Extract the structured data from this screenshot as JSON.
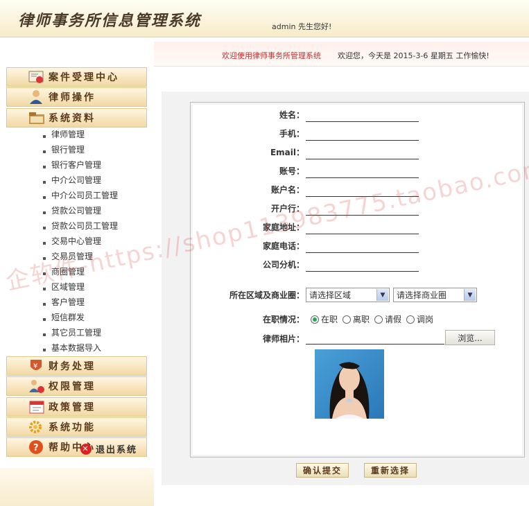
{
  "header": {
    "app_title": "律师事务所信息管理系统",
    "greeting": "admin 先生您好!"
  },
  "topbar": {
    "welcome": "欢迎使用律师事务所管理系统",
    "date_text": "欢迎您，今天是 2015-3-6 星期五 工作愉快!"
  },
  "sidebar": {
    "menus": [
      {
        "label": "案件受理中心",
        "icon": "certificate-icon"
      },
      {
        "label": "律师操作",
        "icon": "user-icon"
      },
      {
        "label": "系统资料",
        "icon": "folder-icon"
      },
      {
        "label": "财务处理",
        "icon": "yen-shield-icon"
      },
      {
        "label": "权限管理",
        "icon": "lock-user-icon"
      },
      {
        "label": "政策管理",
        "icon": "calendar-icon"
      },
      {
        "label": "系统功能",
        "icon": "gear-icon"
      },
      {
        "label": "帮助中心",
        "icon": "help-icon"
      }
    ],
    "subitems": [
      "律师管理",
      "银行管理",
      "银行客户管理",
      "中介公司管理",
      "中介公司员工管理",
      "贷款公司管理",
      "贷款公司员工管理",
      "交易中心管理",
      "交易员管理",
      "商圈管理",
      "区域管理",
      "客户管理",
      "短信群发",
      "其它员工管理",
      "基本数据导入"
    ],
    "logout": "退出系统"
  },
  "form": {
    "fields": [
      "姓名：",
      "手机：",
      "Email：",
      "账号：",
      "账户名：",
      "开户行：",
      "家庭地址：",
      "家庭电话：",
      "公司分机："
    ],
    "region_label": "所在区域及商业圈：",
    "region_select": "请选择区域",
    "area_select": "请选择商业圈",
    "status_label": "在职情况：",
    "status_options": [
      "在职",
      "离职",
      "请假",
      "调岗"
    ],
    "status_selected": 0,
    "photo_label": "律师相片：",
    "browse": "浏览...",
    "submit": "确认提交",
    "reset": "重新选择"
  },
  "watermark": "企软件-https://shop113983775.taobao.com"
}
